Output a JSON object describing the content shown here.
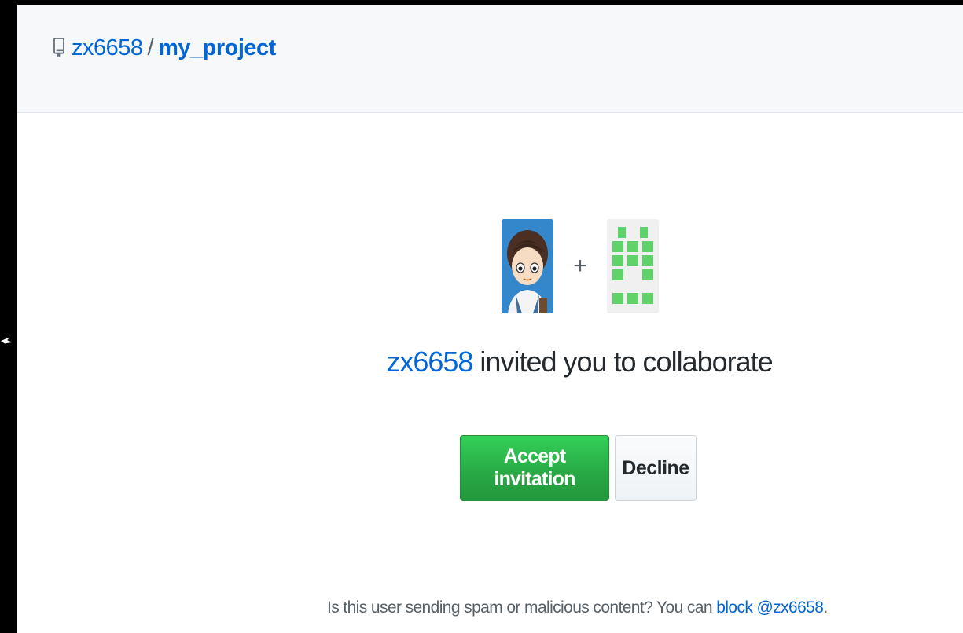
{
  "header": {
    "owner": "zx6658",
    "separator": "/",
    "repo": "my_project",
    "icon": "repo-icon"
  },
  "invitation": {
    "inviter": "zx6658",
    "message": "invited you to collaborate",
    "plus": "+",
    "avatars": [
      "user-avatar",
      "repo-identicon"
    ]
  },
  "actions": {
    "accept_label": "Accept invitation",
    "decline_label": "Decline"
  },
  "spam_note": {
    "prefix": "Is this user sending spam or malicious content? You can",
    "link": "block @zx6658",
    "suffix": "."
  },
  "colors": {
    "link": "#0366d6",
    "accept": "#28a745",
    "header_bg": "#f6f8fa"
  }
}
